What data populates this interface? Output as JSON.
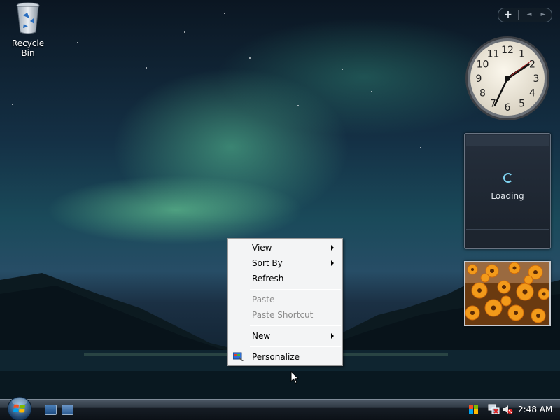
{
  "desktop": {
    "icons": [
      {
        "label": "Recycle Bin"
      }
    ]
  },
  "sidebar": {
    "controls": {
      "add": "+",
      "prev": "◄",
      "next": "►"
    },
    "clock_gadget": {
      "numerals": [
        "12",
        "1",
        "2",
        "3",
        "4",
        "5",
        "6",
        "7",
        "8",
        "9",
        "10",
        "11"
      ]
    },
    "weather_gadget": {
      "status": "Loading"
    },
    "slideshow_gadget": {
      "image": "orange-flowers-photo"
    }
  },
  "context_menu": {
    "items": [
      {
        "label": "View",
        "submenu": true,
        "enabled": true
      },
      {
        "label": "Sort By",
        "submenu": true,
        "enabled": true
      },
      {
        "label": "Refresh",
        "submenu": false,
        "enabled": true
      },
      {
        "label": "Paste",
        "submenu": false,
        "enabled": false
      },
      {
        "label": "Paste Shortcut",
        "submenu": false,
        "enabled": false
      },
      {
        "label": "New",
        "submenu": true,
        "enabled": true
      },
      {
        "label": "Personalize",
        "submenu": false,
        "enabled": true,
        "icon": "personalize-icon"
      }
    ]
  },
  "taskbar": {
    "start_button": "windows-orb-icon",
    "quick_launch": [
      "show-desktop-icon",
      "switch-windows-icon"
    ],
    "tray": {
      "icons": [
        "windows-security-icon",
        "network-icon",
        "volume-muted-icon"
      ],
      "clock": "2:48 AM"
    }
  },
  "colors": {
    "taskbar": "#161d25",
    "menu_background": "#f3f4f5",
    "menu_border": "#979797",
    "disabled_text": "#8d8d8d",
    "weather_loading_accent": "#7fd3f0"
  }
}
